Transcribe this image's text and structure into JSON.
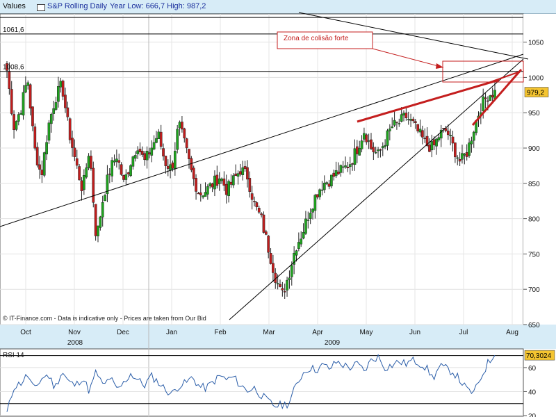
{
  "header": {
    "values_label": "Values",
    "title": "S&P Rolling Daily",
    "year_range": "Year Low: 666,7 High: 987,2"
  },
  "footer_note": "© IT-Finance.com - Data is indicative only - Prices are taken from Our Bid",
  "annotation": {
    "text": "Zona de colisão forte"
  },
  "chart_data": [
    {
      "type": "candlestick",
      "title": "S&P Rolling Daily",
      "ylim": [
        650,
        1090
      ],
      "y_ticks": [
        650,
        700,
        750,
        800,
        850,
        900,
        950,
        1000,
        1050
      ],
      "x_months": [
        "Oct",
        "Nov",
        "Dec",
        "Jan",
        "Feb",
        "Mar",
        "Apr",
        "May",
        "Jun",
        "Jul",
        "Aug"
      ],
      "x_years": [
        "2008",
        "2009"
      ],
      "last_value_label": "979,2",
      "horizontal_levels": [
        {
          "value": 1061.6,
          "label": "1061,6"
        },
        {
          "value": 1008.6,
          "label": "1008,6"
        }
      ],
      "weekly_closes": [
        1010,
        930,
        955,
        1000,
        900,
        860,
        930,
        970,
        990,
        925,
        880,
        840,
        900,
        770,
        830,
        870,
        890,
        850,
        880,
        905,
        880,
        900,
        920,
        880,
        870,
        935,
        900,
        860,
        835,
        840,
        850,
        860,
        840,
        855,
        870,
        860,
        820,
        800,
        760,
        720,
        690,
        720,
        760,
        780,
        810,
        835,
        850,
        855,
        865,
        870,
        880,
        900,
        925,
        900,
        890,
        910,
        930,
        935,
        945,
        935,
        920,
        905,
        900,
        920,
        925,
        900,
        880,
        895,
        930,
        960,
        975,
        979.2
      ],
      "grid": true
    },
    {
      "type": "line",
      "title": "RSI 14",
      "ylim": [
        20,
        75
      ],
      "y_ticks": [
        20,
        40,
        60
      ],
      "last_value_label": "70,3024",
      "values": [
        22,
        44,
        47,
        54,
        41,
        51,
        54,
        43,
        57,
        48,
        45,
        52,
        40,
        57,
        44,
        52,
        41,
        47,
        55,
        50,
        45,
        53,
        48,
        42,
        38,
        45,
        47,
        52,
        44,
        43,
        48,
        53,
        50,
        52,
        45,
        41,
        43,
        37,
        32,
        28,
        29,
        30,
        44,
        55,
        60,
        58,
        62,
        59,
        65,
        62,
        60,
        63,
        57,
        66,
        69,
        60,
        62,
        65,
        63,
        66,
        64,
        60,
        51,
        61,
        59,
        56,
        49,
        41,
        39,
        52,
        64,
        70.3
      ]
    }
  ]
}
